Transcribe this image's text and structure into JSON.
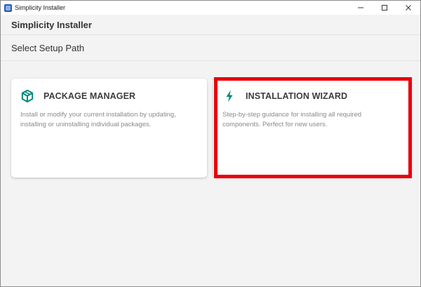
{
  "window": {
    "title": "Simplicity Installer",
    "controls": {
      "minimize": "minimize-icon",
      "maximize": "maximize-icon",
      "close": "close-icon"
    }
  },
  "app": {
    "title": "Simplicity Installer"
  },
  "section": {
    "title": "Select Setup Path"
  },
  "options": [
    {
      "icon": "package-icon",
      "title": "PACKAGE MANAGER",
      "description": "Install or modify your current installation by updating, installing or uninstalling individual packages."
    },
    {
      "icon": "lightning-icon",
      "title": "INSTALLATION WIZARD",
      "description": "Step-by-step guidance for installing all required components. Perfect for new users."
    }
  ],
  "colors": {
    "accent": "#00897b",
    "highlight": "#e8000b",
    "app_icon": "#1f5fb8"
  }
}
